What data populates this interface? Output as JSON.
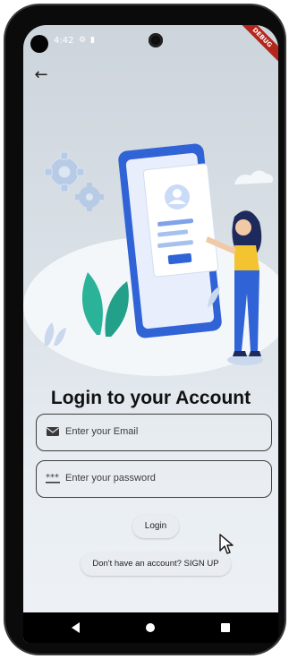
{
  "status_bar": {
    "time": "4:42",
    "icons": [
      "settings-icon",
      "sim-card-icon"
    ],
    "debug_label": "DEBUG"
  },
  "app_bar": {
    "back_icon": "back-arrow-icon"
  },
  "illustration": {
    "name": "person-with-phone-profile-illustration"
  },
  "login": {
    "title": "Login to your Account",
    "email_placeholder": "Enter your Email",
    "password_placeholder": "Enter your password",
    "login_label": "Login",
    "signup_label": "Don't have an account? SIGN UP"
  },
  "nav_bar": {
    "items": [
      "back-triangle-icon",
      "home-circle-icon",
      "recents-square-icon"
    ]
  },
  "colors": {
    "phone_blue": "#2f63d6",
    "accent_yellow": "#f4c430",
    "leaf_teal": "#2bb39a"
  }
}
